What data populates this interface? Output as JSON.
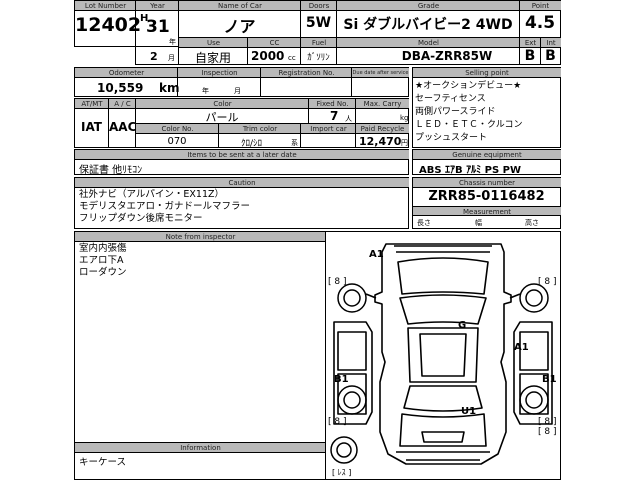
{
  "header_row": {
    "lot_label": "Lot Number",
    "lot": "12402",
    "year_label": "Year",
    "era": "H",
    "year": "31",
    "year_unit": "年",
    "month": "2",
    "month_unit": "月",
    "name_label": "Name of Car",
    "name": "ノア",
    "use_label": "Use",
    "use": "自家用",
    "cc_label": "CC",
    "cc": "2000",
    "cc_unit": "cc",
    "doors_label": "Doors",
    "doors": "5W",
    "fuel_label": "Fuel",
    "fuel": "ｶﾞｿﾘﾝ",
    "grade_label": "Grade",
    "grade": "Si ダブルバイビー2 4WD",
    "model_label": "Model",
    "model": "DBA-ZRR85W",
    "point_label": "Point",
    "point": "4.5",
    "ext_label": "Ext",
    "ext": "B",
    "int_label": "Int",
    "int": "B"
  },
  "odometer_row": {
    "odometer_label": "Odometer",
    "odometer": "10,559",
    "odometer_unit": "km",
    "inspection_label": "Inspection",
    "insp_year_unit": "年",
    "insp_month_unit": "月",
    "registration_label": "Registration No.",
    "due_label": "Due date after service"
  },
  "selling_point": {
    "label": "Selling point",
    "lines": [
      "★オークションデビュー★",
      "セーフティセンス",
      "両側パワースライド",
      "ＬＥＤ・ＥＴＣ・クルコン",
      "プッシュスタート"
    ]
  },
  "spec_row": {
    "atmt_label": "AT/MT",
    "atmt": "IAT",
    "ac_label": "A / C",
    "ac": "AAC",
    "color_label": "Color",
    "color": "パール",
    "fixed_label": "Fixed No.",
    "fixed": "7",
    "fixed_unit": "人",
    "carry_label": "Max. Carry",
    "carry_unit": "kg",
    "color_no_label": "Color No.",
    "color_no": "070",
    "trim_label": "Trim color",
    "trim": "ｸﾛ/ｼﾛ",
    "trim_unit": "系",
    "import_label": "Import car",
    "recycle_label": "Paid Recycle",
    "recycle": "12,470",
    "recycle_unit": "円"
  },
  "items": {
    "label": "Items to be sent at a later date",
    "value": "保証書 他ﾘﾓｺﾝ"
  },
  "equipment": {
    "label": "Genuine equipment",
    "value": "ABS ｴｱB ｱﾙﾐ PS PW"
  },
  "caution": {
    "label": "Caution",
    "lines": [
      "社外ナビ（アルパイン・EX11Z）",
      "モデリスタエアロ・ガナドールマフラー",
      "フリップダウン後席モニター"
    ]
  },
  "chassis": {
    "label": "Chassis number",
    "value": "ZRR85-0116482",
    "measure_label": "Measurement",
    "length_label": "長さ",
    "width_label": "幅",
    "height_label": "高さ"
  },
  "inspector_note": {
    "label": "Note from inspector",
    "lines": [
      "室内内張傷",
      "エアロ下A",
      "ローダウン"
    ]
  },
  "information": {
    "label": "Information",
    "lines": [
      "キーケース"
    ]
  },
  "diagram": {
    "marks": {
      "front": "A1",
      "roof": "G",
      "right_side": "A1",
      "left_rear": "B1",
      "right_rear": "B1",
      "rear": "U1"
    },
    "tires": [
      "[ 8 ]",
      "[ 8 ]",
      "[ 8 ]",
      "[ 8 ]",
      "[ 8 ]"
    ],
    "spare": "[ ﾚｽ ]"
  }
}
